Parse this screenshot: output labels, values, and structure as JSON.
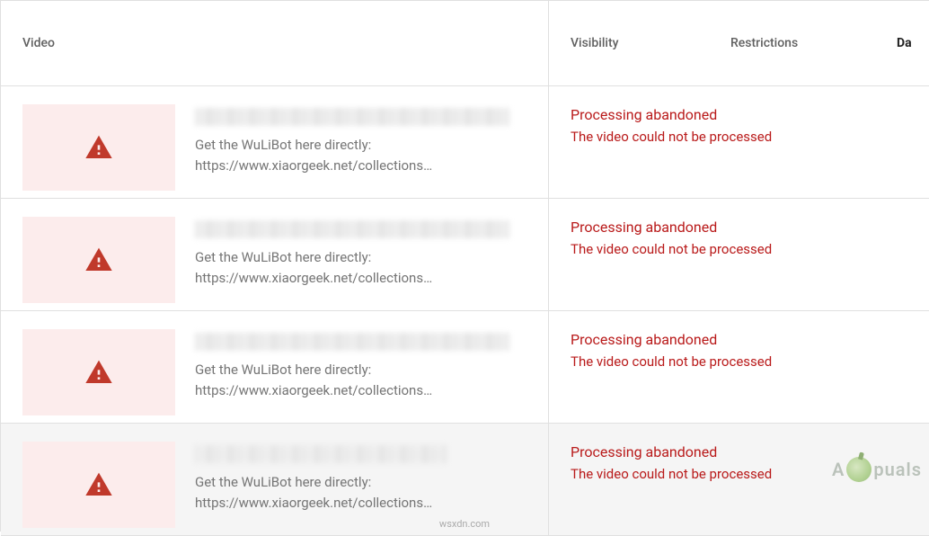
{
  "header": {
    "video": "Video",
    "visibility": "Visibility",
    "restrictions": "Restrictions",
    "date": "Da"
  },
  "rows": [
    {
      "desc_line1": "Get the WuLiBot here directly:",
      "desc_line2": "https://www.xiaorgeek.net/collections…",
      "status_title": "Processing abandoned",
      "status_sub": "The video could not be processed"
    },
    {
      "desc_line1": "Get the WuLiBot here directly:",
      "desc_line2": "https://www.xiaorgeek.net/collections…",
      "status_title": "Processing abandoned",
      "status_sub": "The video could not be processed"
    },
    {
      "desc_line1": "Get the WuLiBot here directly:",
      "desc_line2": "https://www.xiaorgeek.net/collections…",
      "status_title": "Processing abandoned",
      "status_sub": "The video could not be processed"
    },
    {
      "desc_line1": "Get the WuLiBot here directly:",
      "desc_line2": "https://www.xiaorgeek.net/collections…",
      "status_title": "Processing abandoned",
      "status_sub": "The video could not be processed"
    }
  ],
  "watermark": {
    "left": "A",
    "right": "puals"
  },
  "attribution": "wsxdn.com"
}
